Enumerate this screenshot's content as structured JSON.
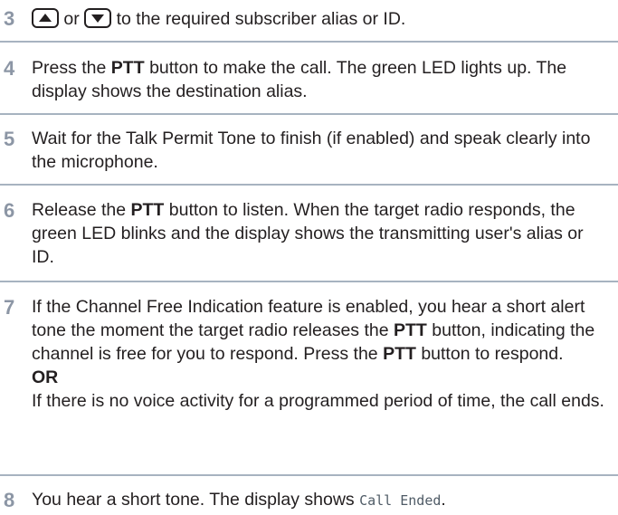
{
  "steps": [
    {
      "number": "3",
      "or_word": "or",
      "text": "to the required subscriber alias or ID.",
      "icons": [
        "up-arrow-button-icon",
        "down-arrow-button-icon"
      ]
    },
    {
      "number": "4",
      "pre": "Press the",
      "bold": "PTT",
      "post": "button to make the call. The green LED lights up. The display shows the destination alias."
    },
    {
      "number": "5",
      "text": "Wait for the Talk Permit Tone to finish (if enabled) and speak clearly into the microphone."
    },
    {
      "number": "6",
      "pre": "Release the",
      "bold": "PTT",
      "post": "button to listen. When the target radio responds, the green LED blinks and the display shows the transmitting user's alias or ID."
    },
    {
      "number": "7",
      "line1": "If the Channel Free Indication feature is enabled, you hear a short alert tone the moment the target radio releases the",
      "bold1": "PTT",
      "line1b": "button, indicating the channel is free for you to respond. Press the",
      "bold2": "PTT",
      "line1c": "button to respond.",
      "or_label": "OR",
      "line2": "If there is no voice activity for a programmed period of time, the call ends."
    },
    {
      "number": "8",
      "text": "You hear a short tone. The display shows",
      "display_text": "Call Ended",
      "end": "."
    }
  ],
  "colors": {
    "step_number": "#8c96a5",
    "rule": "#a7b3c0",
    "text": "#231f20"
  }
}
